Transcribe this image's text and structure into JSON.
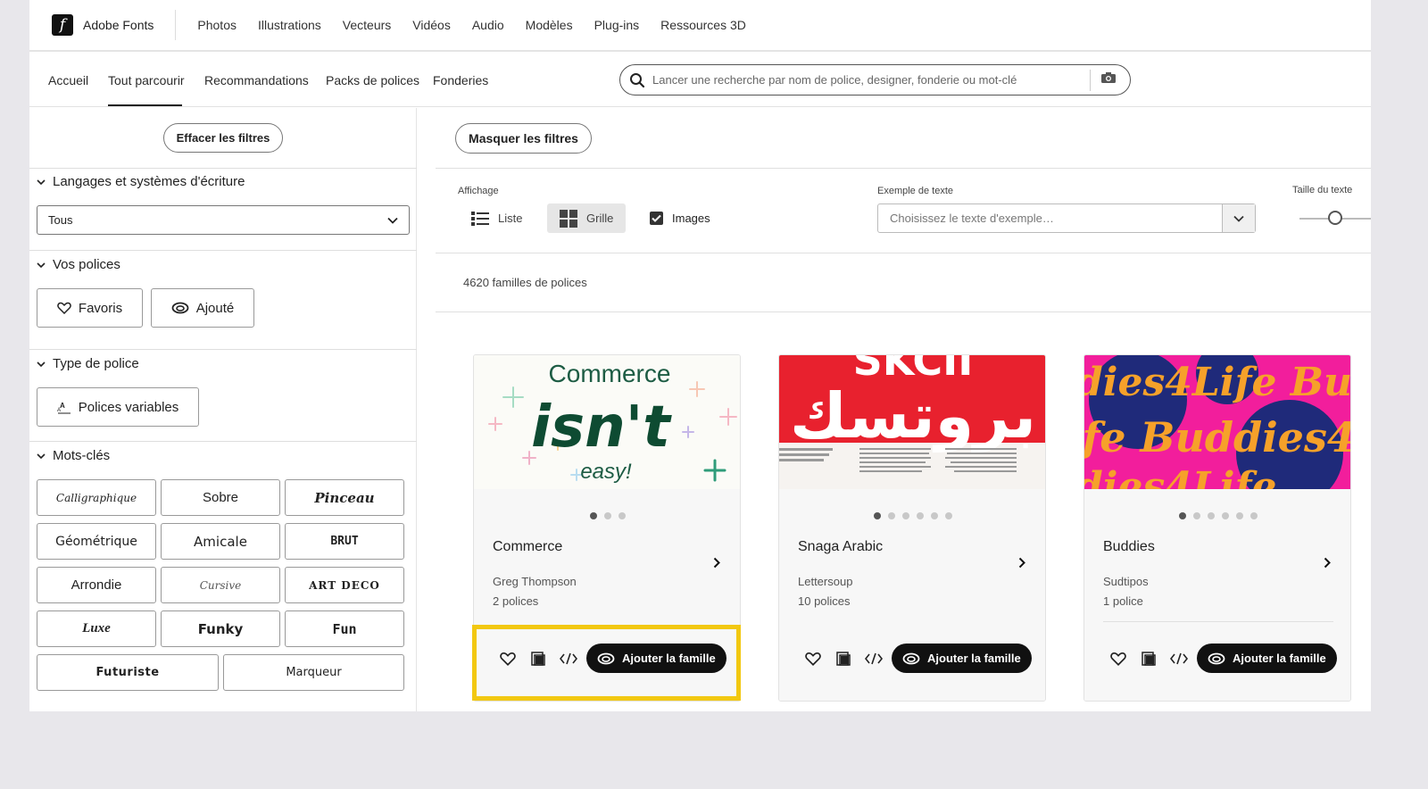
{
  "brand": {
    "name": "Adobe Fonts",
    "logo_letter": "f"
  },
  "top_nav": [
    "Photos",
    "Illustrations",
    "Vecteurs",
    "Vidéos",
    "Audio",
    "Modèles",
    "Plug-ins",
    "Ressources 3D"
  ],
  "sub_nav": [
    "Accueil",
    "Tout parcourir",
    "Recommandations",
    "Packs de polices",
    "Fonderies"
  ],
  "sub_nav_active": "Tout parcourir",
  "search": {
    "placeholder": "Lancer une recherche par nom de police, designer, fonderie ou mot-clé"
  },
  "sidebar": {
    "clear_filters": "Effacer les filtres",
    "languages": {
      "heading": "Langages et systèmes d'écriture",
      "selected": "Tous"
    },
    "your_fonts": {
      "heading": "Vos polices",
      "favorites": "Favoris",
      "added": "Ajouté"
    },
    "font_type": {
      "heading": "Type de police",
      "variable": "Polices variables"
    },
    "keywords": {
      "heading": "Mots-clés",
      "items": [
        "Calligraphique",
        "Sobre",
        "Pinceau",
        "Géométrique",
        "Amicale",
        "BRUT",
        "Arrondie",
        "Cursive",
        "ART DECO",
        "Luxe",
        "Funky",
        "Fun",
        "Futuriste",
        "Marqueur"
      ]
    }
  },
  "toolbar": {
    "hide_filters": "Masquer les filtres",
    "view_label": "Affichage",
    "list": "Liste",
    "grid": "Grille",
    "images": "Images",
    "images_checked": true,
    "sample_label": "Exemple de texte",
    "sample_placeholder": "Choisissez le texte d'exemple…",
    "size_label": "Taille du texte",
    "size_level_percent": 50
  },
  "results_count": "4620 familles de polices",
  "cards": [
    {
      "name": "Commerce",
      "foundry": "Greg Thompson",
      "count": "2 polices",
      "dots": 3,
      "active_dot": 0,
      "preview": [
        "Commerce",
        "isn't",
        "easy!"
      ],
      "add_label": "Ajouter la famille"
    },
    {
      "name": "Snaga Arabic",
      "foundry": "Lettersoup",
      "count": "10 polices",
      "dots": 6,
      "active_dot": 0,
      "preview": [
        "SKCII",
        "بروتسك"
      ],
      "add_label": "Ajouter la famille"
    },
    {
      "name": "Buddies",
      "foundry": "Sudtipos",
      "count": "1 police",
      "dots": 6,
      "active_dot": 0,
      "preview": [
        "dies4Life Bu",
        "ife Buddies4",
        "dies4Life"
      ],
      "add_label": "Ajouter la famille"
    }
  ],
  "colors": {
    "highlight": "#f2c811",
    "button_dark": "#111111",
    "buddies_pink": "#f21e9c",
    "buddies_navy": "#1f2a7a",
    "buddies_orange": "#f6a12a",
    "snaga_red": "#e8212e",
    "commerce_green": "#0e4b32"
  }
}
